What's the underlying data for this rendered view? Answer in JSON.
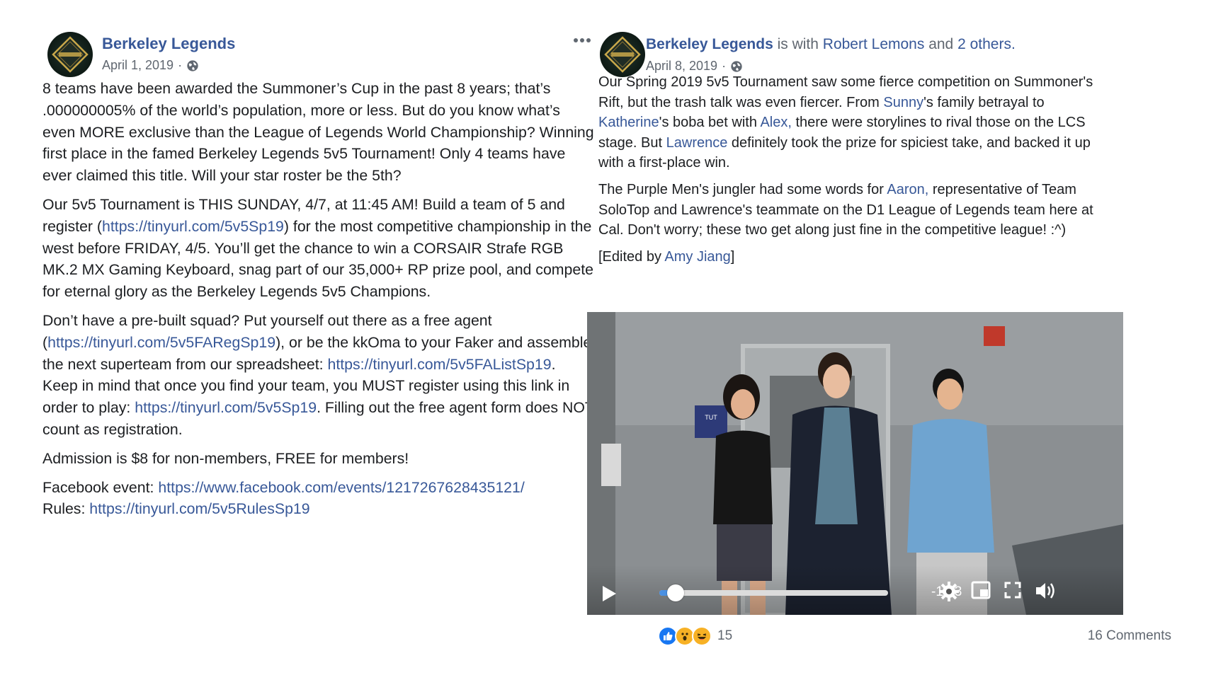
{
  "left_post": {
    "author": "Berkeley Legends",
    "date": "April 1, 2019",
    "separator": "·",
    "paragraphs": [
      [
        {
          "text": "8 teams have been awarded the Summoner’s Cup in the past 8 years; that’s .000000005% of the world’s population, more or less. But do you know what’s even MORE exclusive than the League of Legends World Championship? Winning first place in the famed Berkeley Legends 5v5 Tournament! Only 4 teams have ever claimed this title. Will your star roster be the 5th?"
        }
      ],
      [
        {
          "text": "Our 5v5 Tournament is THIS SUNDAY, 4/7, at 11:45 AM! Build a team of 5 and register ("
        },
        {
          "text": "https://tinyurl.com/5v5Sp19",
          "link": true
        },
        {
          "text": ") for the most competitive championship in the west before FRIDAY, 4/5. You’ll get the chance to win a CORSAIR Strafe RGB MK.2 MX Gaming Keyboard, snag part of our 35,000+ RP prize pool, and compete for eternal glory as the Berkeley Legends 5v5 Champions."
        }
      ],
      [
        {
          "text": "Don’t have a pre-built squad? Put yourself out there as a free agent ("
        },
        {
          "text": "https://tinyurl.com/5v5FARegSp19",
          "link": true
        },
        {
          "text": "), or be the kkOma to your Faker and assemble the next superteam from our spreadsheet: "
        },
        {
          "text": "https://tinyurl.com/5v5FAListSp19",
          "link": true
        },
        {
          "text": ". Keep in mind that once you find your team, you MUST register using this link in order to play: "
        },
        {
          "text": "https://tinyurl.com/5v5Sp19",
          "link": true
        },
        {
          "text": ". Filling out the free agent form does NOT count as registration."
        }
      ],
      [
        {
          "text": "Admission is $8 for non-members, FREE for members!"
        }
      ],
      [
        {
          "text": "Facebook event: "
        },
        {
          "text": "https://www.facebook.com/events/1217267628435121/",
          "link": true
        },
        {
          "text": "\n"
        },
        {
          "text": "Rules: "
        },
        {
          "text": "https://tinyurl.com/5v5RulesSp19",
          "link": true
        }
      ]
    ]
  },
  "right_post": {
    "author": "Berkeley Legends",
    "with_text": " is with ",
    "tagged_person": "Robert Lemons",
    "and_text": " and ",
    "others": "2 others.",
    "date": "April 8, 2019",
    "separator": "·",
    "paragraphs": [
      [
        {
          "text": "Our Spring 2019 5v5 Tournament saw some fierce competition on Summoner's Rift, but the trash talk was even fiercer. From "
        },
        {
          "text": "Sunny",
          "link": true
        },
        {
          "text": "'s family betrayal to "
        },
        {
          "text": "Katherine",
          "link": true
        },
        {
          "text": "'s boba bet with "
        },
        {
          "text": "Alex,",
          "link": true
        },
        {
          "text": " there were storylines to rival those on the LCS stage. But "
        },
        {
          "text": "Lawrence",
          "link": true
        },
        {
          "text": " definitely took the prize for spiciest take, and backed it up with a first-place win."
        }
      ],
      [
        {
          "text": "The Purple Men's jungler had some words for "
        },
        {
          "text": "Aaron,",
          "link": true
        },
        {
          "text": " representative of Team SoloTop and Lawrence's teammate on the D1 League of Legends team here at Cal. Don't worry; these two get along just fine in the competitive league! :^)"
        }
      ],
      [
        {
          "text": "[Edited by "
        },
        {
          "text": "Amy Jiang",
          "link": true
        },
        {
          "text": "]"
        }
      ]
    ],
    "video": {
      "time_remaining": "-1:13",
      "progress": 0.07,
      "door_sign": "TUT\nAL"
    },
    "reaction_count": "15",
    "comments": "16 Comments"
  },
  "colors": {
    "link": "#385898",
    "meta": "#606770",
    "like": "#1877f2",
    "wow": "#f7b125",
    "haha": "#f7b125"
  }
}
